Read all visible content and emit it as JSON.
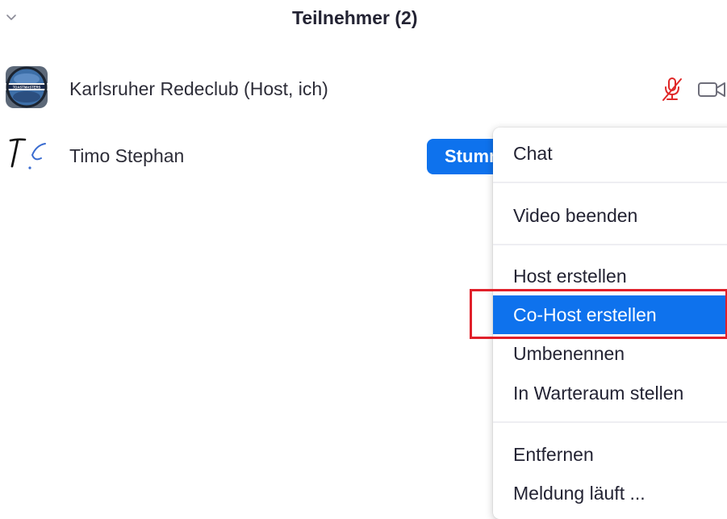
{
  "header": {
    "title": "Teilnehmer (2)",
    "collapse_icon": "chevron-down-icon"
  },
  "participants": [
    {
      "name": "Karlsruher Redeclub (Host, ich)",
      "avatar": "toastmasters-logo",
      "mic_icon": "mic-muted-icon",
      "mic_color": "#e02828",
      "video_icon": "video-camera-icon"
    },
    {
      "name": "Timo Stephan",
      "avatar": "initials-tc-signature",
      "action_button": "Stumm"
    }
  ],
  "context_menu": {
    "items": [
      {
        "label": "Chat"
      },
      {
        "label": "Video beenden"
      },
      {
        "label": "Host erstellen"
      },
      {
        "label": "Co-Host erstellen",
        "selected": true
      },
      {
        "label": "Umbenennen"
      },
      {
        "label": "In Warteraum stellen"
      },
      {
        "label": "Entfernen"
      },
      {
        "label": "Meldung läuft ..."
      }
    ]
  },
  "colors": {
    "accent": "#0e72ed",
    "highlight_frame": "#e0202a",
    "muted_mic": "#e02828"
  }
}
